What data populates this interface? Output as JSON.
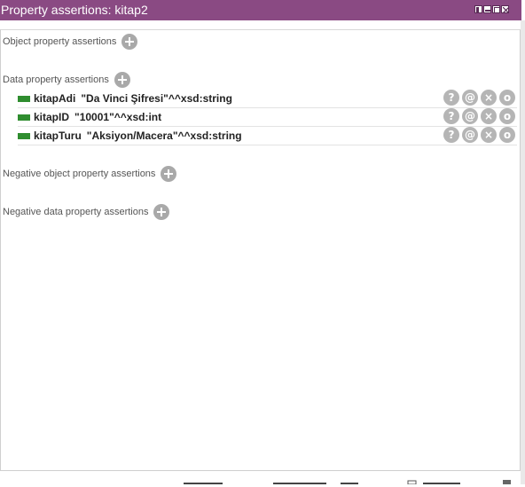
{
  "window": {
    "title": "Property assertions: kitap2"
  },
  "sections": {
    "object_property": "Object property assertions",
    "data_property": "Data property assertions",
    "negative_object_property": "Negative object property assertions",
    "negative_data_property": "Negative data property assertions"
  },
  "data_assertions": [
    {
      "property": "kitapAdi",
      "value": "\"Da Vinci Şifresi\"^^xsd:string"
    },
    {
      "property": "kitapID",
      "value": "\"10001\"^^xsd:int"
    },
    {
      "property": "kitapTuru",
      "value": "\"Aksiyon/Macera\"^^xsd:string"
    }
  ],
  "row_actions": {
    "explain": "?",
    "annotate": "@",
    "delete": "×",
    "edit": "o"
  },
  "icons": {
    "add": "plus-circle-icon",
    "explain": "question-icon",
    "annotate": "at-icon",
    "delete": "close-icon",
    "edit": "edit-ring-icon"
  },
  "colors": {
    "titlebar": "#8a4a83",
    "data_property_swatch": "#2f8d2f",
    "action_button": "#b5b5b5"
  }
}
